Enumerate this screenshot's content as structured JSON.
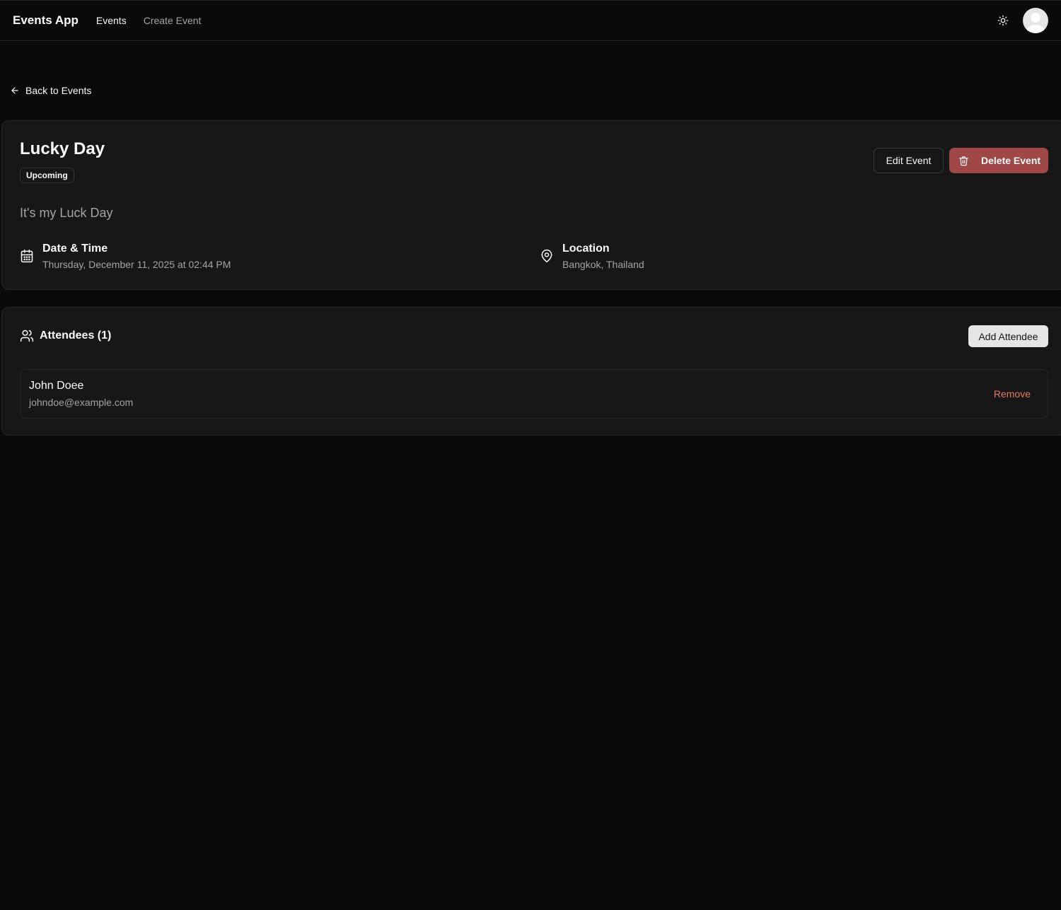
{
  "navbar": {
    "brand": "Events App",
    "links": [
      {
        "label": "Events",
        "active": true
      },
      {
        "label": "Create Event",
        "active": false
      }
    ],
    "theme_icon": "sun-icon",
    "avatar_icon": "user-avatar-icon"
  },
  "back_link": {
    "label": "Back to Events",
    "icon": "arrow-left-icon"
  },
  "event": {
    "title": "Lucky Day",
    "status": "Upcoming",
    "description": "It's my Luck Day",
    "edit_label": "Edit Event",
    "delete_label": "Delete Event",
    "delete_icon": "trash-icon",
    "datetime": {
      "label": "Date & Time",
      "value": "Thursday, December 11, 2025 at 02:44 PM",
      "icon": "calendar-icon"
    },
    "location": {
      "label": "Location",
      "value": "Bangkok, Thailand",
      "icon": "map-pin-icon"
    }
  },
  "attendees": {
    "title": "Attendees (1)",
    "icon": "users-icon",
    "add_label": "Add Attendee",
    "list": [
      {
        "name": "John Doee",
        "email": "johndoe@example.com",
        "remove_label": "Remove"
      }
    ]
  },
  "colors": {
    "background": "#0a0a0a",
    "card": "#171717",
    "border": "#262626",
    "danger": "#a04747",
    "remove_text": "#e07a5f",
    "muted_text": "#a3a3a3"
  }
}
